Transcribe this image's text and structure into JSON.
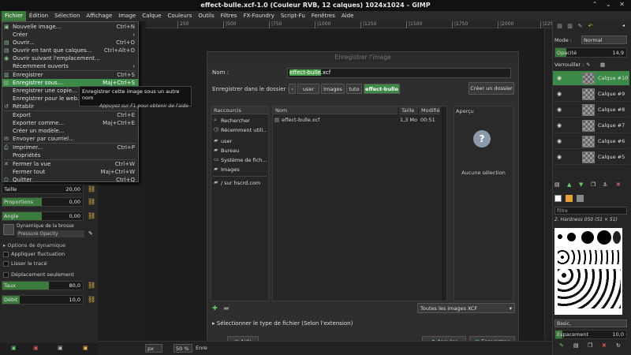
{
  "window": {
    "title": "effect-bulle.xcf-1.0 (Couleur RVB, 12 calques) 1024x1024 – GIMP",
    "controls": "⌃ ⌄ ✕"
  },
  "menubar": {
    "items": [
      "Fichier",
      "Édition",
      "Sélection",
      "Affichage",
      "Image",
      "Calque",
      "Couleurs",
      "Outils",
      "Filtres",
      "FX-Foundry",
      "Script-Fu",
      "Fenêtres",
      "Aide"
    ]
  },
  "ruler": {
    "ticks": [
      "250",
      "|500",
      "|750",
      "|1000",
      "|1250",
      "|1500",
      "|1750",
      "|2000",
      "|2250"
    ]
  },
  "file_menu": {
    "items": [
      {
        "label": "Nouvelle image...",
        "shortcut": "Ctrl+N"
      },
      {
        "label": "Créer",
        "shortcut": "›"
      },
      {
        "label": "Ouvrir...",
        "shortcut": "Ctrl+O"
      },
      {
        "label": "Ouvrir en tant que calques...",
        "shortcut": "Ctrl+Alt+O"
      },
      {
        "label": "Ouvrir suivant l'emplacement...",
        "shortcut": ""
      },
      {
        "label": "Récemment ouverts",
        "shortcut": "›"
      },
      {
        "label": "Enregistrer",
        "shortcut": "Ctrl+S"
      },
      {
        "label": "Enregistrer sous...",
        "shortcut": "Maj+Ctrl+S"
      },
      {
        "label": "Enregistrer une copie...",
        "shortcut": ""
      },
      {
        "label": "Enregistrer pour le web...",
        "shortcut": ""
      },
      {
        "label": "Rétablir",
        "shortcut": ""
      },
      {
        "label": "Export",
        "shortcut": "Ctrl+E"
      },
      {
        "label": "Exporter comme...",
        "shortcut": "Maj+Ctrl+E"
      },
      {
        "label": "Créer un modèle...",
        "shortcut": ""
      },
      {
        "label": "Envoyer par courriel...",
        "shortcut": ""
      },
      {
        "label": "Imprimer...",
        "shortcut": "Ctrl+P"
      },
      {
        "label": "Propriétés",
        "shortcut": ""
      },
      {
        "label": "Fermer la vue",
        "shortcut": "Ctrl+W"
      },
      {
        "label": "Fermer tout",
        "shortcut": "Maj+Ctrl+W"
      },
      {
        "label": "Quitter",
        "shortcut": "Ctrl+Q"
      }
    ]
  },
  "tooltip": {
    "text": "Enregistrer cette image sous un autre nom",
    "hint": "Appuyez sur F1 pour obtenir de l'aide"
  },
  "tool_options": {
    "size": {
      "label": "Taille",
      "value": "20,00"
    },
    "ratio": {
      "label": "Proportions",
      "value": "0,00"
    },
    "angle": {
      "label": "Angle",
      "value": "0,00"
    },
    "dynamics_label": "Dynamique de la brosse",
    "dynamics_value": "Pressure Opacity",
    "dynamics_options": "Options de dynamique",
    "apply_jitter": "Appliquer fluctuation",
    "smooth_stroke": "Lisser le tracé",
    "incremental": "Déplacement seulement",
    "rate": {
      "label": "Taux",
      "value": "80,0",
      "fill": 0.8
    },
    "flow": {
      "label": "Débit",
      "value": "10,0",
      "fill": 0.1
    }
  },
  "dialog": {
    "title": "Enregistrer l'image",
    "name_label": "Nom :",
    "name_selected": "effect-bulle",
    "name_ext": ".xcf",
    "folder_label": "Enregistrer dans le dossier :",
    "path": [
      "user",
      "Images",
      "tuto",
      "effect-bulle"
    ],
    "create_folder": "Créer un dossier",
    "places_header": "Raccourcis",
    "places": [
      "Rechercher",
      "Récemment utili...",
      "user",
      "Bureau",
      "Système de fich...",
      "Images",
      "/ sur hscrd.com"
    ],
    "columns": {
      "name": "Nom",
      "size": "Taille",
      "modified": "Modifié"
    },
    "files": [
      {
        "name": "effect-bulle.xcf",
        "size": "1,3 Mo",
        "modified": "00:51"
      }
    ],
    "preview_header": "Aperçu",
    "no_selection": "Aucune sélection",
    "filter": "Toutes les images XCF",
    "file_type": "Sélectionner le type de fichier (Selon l'extension)",
    "help": "Aide",
    "cancel": "Annuler",
    "save": "Enregistrer"
  },
  "layers_panel": {
    "mode_label": "Mode :",
    "mode_value": "Normal",
    "opacity_label": "Opacité",
    "opacity_value": "14,9",
    "lock_label": "Verrouiller :",
    "layers": [
      "Calque #10",
      "Calque #9",
      "Calque #8",
      "Calque #7",
      "Calque #6",
      "Calque #5"
    ]
  },
  "brushes_panel": {
    "filter": "filtre",
    "brush_name": "2. Hardness 050 (51 × 51)",
    "preset": "Basic,",
    "spacing_label": "Espacement",
    "spacing_value": "10,0"
  },
  "statusbar": {
    "unit": "px",
    "zoom": "50 %",
    "text": "Enre"
  }
}
